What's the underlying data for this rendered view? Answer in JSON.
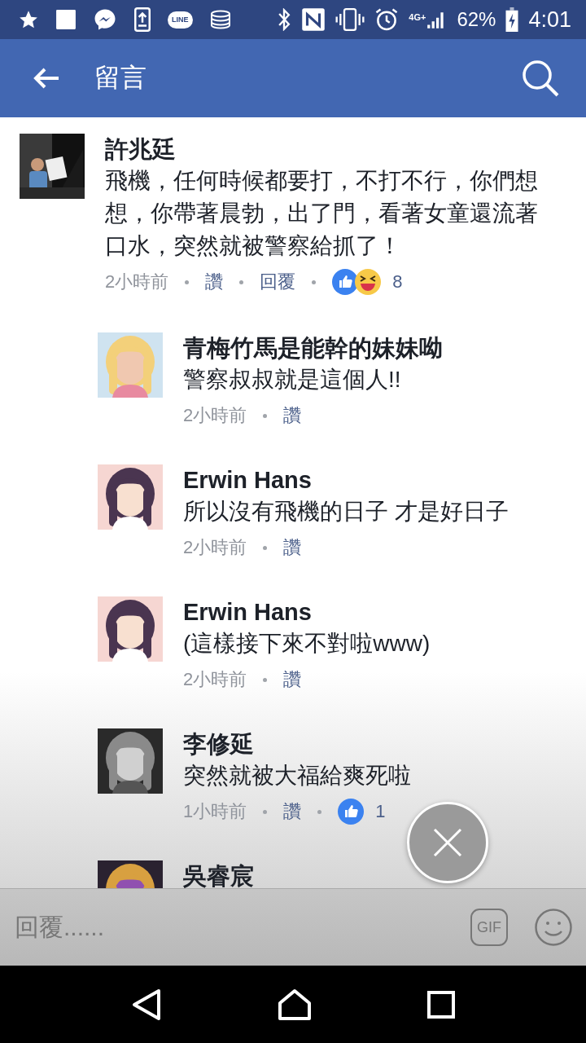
{
  "status_bar": {
    "app_label": "LINE",
    "network": "4G+",
    "battery": "62%",
    "time": "4:01"
  },
  "header": {
    "title": "留言"
  },
  "comments": [
    {
      "author": "許兆廷",
      "text": "飛機，任何時候都要打，不打不行，你們想想，你帶著晨勃，出了門，看著女童還流著口水，突然就被警察給抓了！",
      "time": "2小時前",
      "actions": [
        "讚",
        "回覆"
      ],
      "reactions": [
        {
          "kind": "like"
        },
        {
          "kind": "haha"
        }
      ],
      "reaction_count": "8",
      "children": [
        {
          "author": "青梅竹馬是能幹的妹妹呦",
          "text": "警察叔叔就是這個人!!",
          "time": "2小時前",
          "actions": [
            "讚"
          ]
        },
        {
          "author": "Erwin Hans",
          "text": "所以沒有飛機的日子 才是好日子",
          "time": "2小時前",
          "actions": [
            "讚"
          ]
        },
        {
          "author": "Erwin Hans",
          "text": "(這樣接下來不對啦www)",
          "time": "2小時前",
          "actions": [
            "讚"
          ]
        },
        {
          "author": "李修延",
          "text": "突然就被大福給爽死啦",
          "time": "1小時前",
          "actions": [
            "讚"
          ],
          "reactions": [
            {
              "kind": "like"
            }
          ],
          "reaction_count": "1"
        },
        {
          "author": "吳睿宸"
        }
      ]
    }
  ],
  "composer": {
    "placeholder": "回覆......",
    "gif_label": "GIF"
  }
}
